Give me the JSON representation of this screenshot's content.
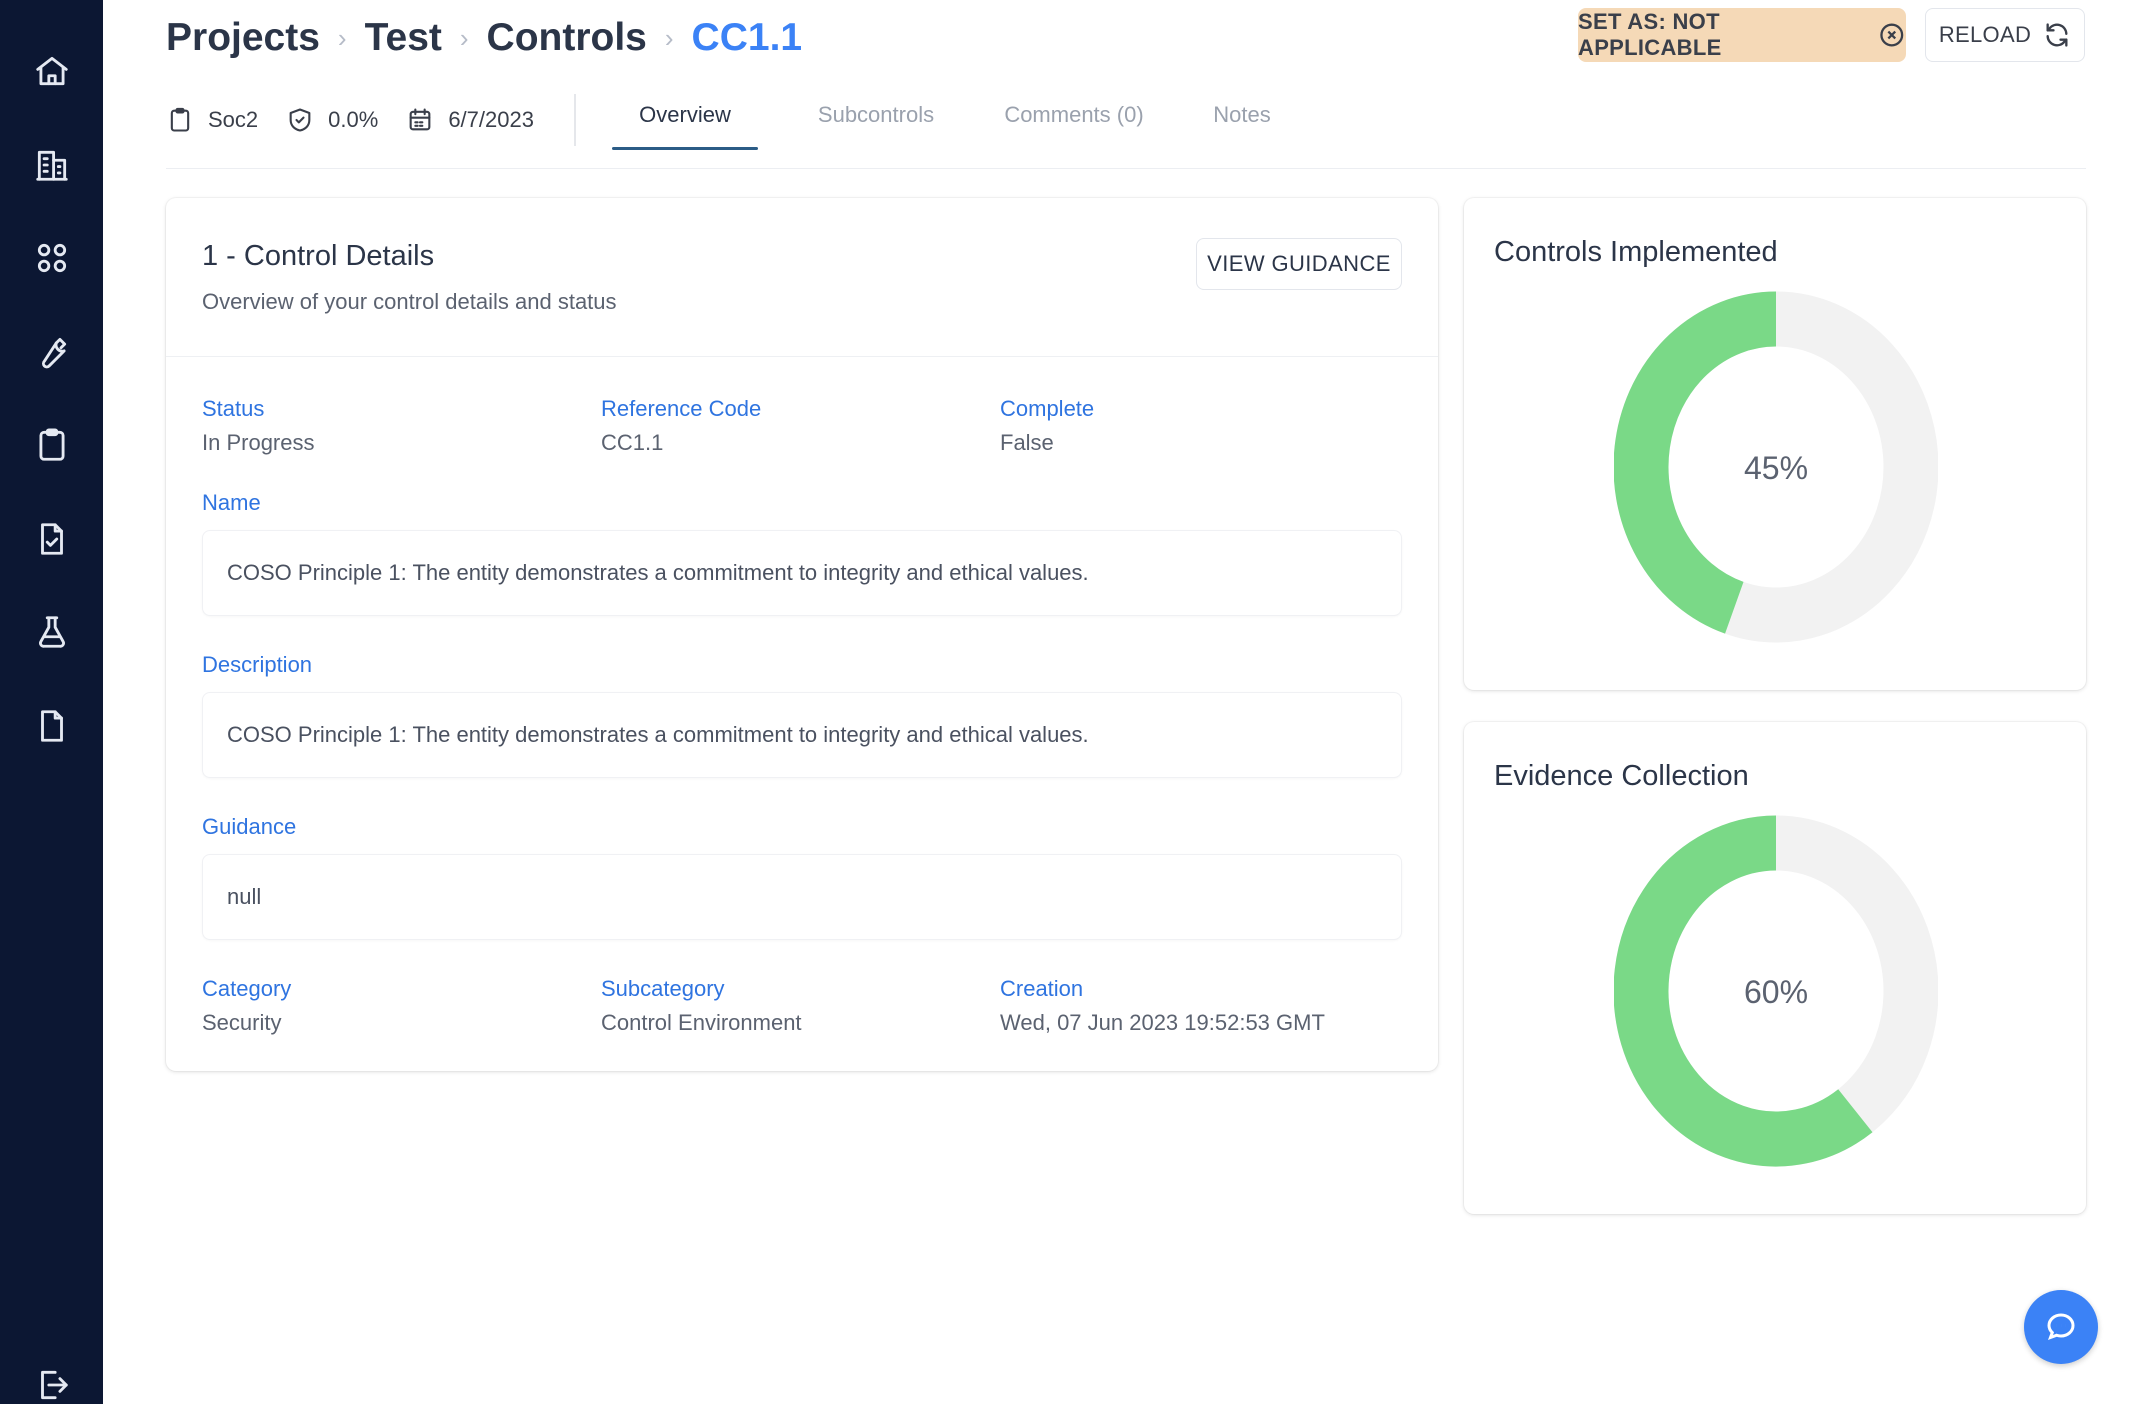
{
  "sidebar": {
    "items": [
      {
        "icon": "home-icon"
      },
      {
        "icon": "building-icon"
      },
      {
        "icon": "apps-grid-icon"
      },
      {
        "icon": "wrench-icon"
      },
      {
        "icon": "clipboard-icon"
      },
      {
        "icon": "document-check-icon"
      },
      {
        "icon": "flask-icon"
      },
      {
        "icon": "file-icon"
      }
    ],
    "logout_icon": "logout-icon"
  },
  "breadcrumb": {
    "items": [
      "Projects",
      "Test",
      "Controls"
    ],
    "current": "CC1.1",
    "separator": "›"
  },
  "header": {
    "set_na_label": "SET AS: NOT APPLICABLE",
    "reload_label": "RELOAD"
  },
  "meta": {
    "framework": "Soc2",
    "percent": "0.0%",
    "date": "6/7/2023"
  },
  "tabs": [
    {
      "label": "Overview",
      "active": true
    },
    {
      "label": "Subcontrols",
      "active": false
    },
    {
      "label": "Comments (0)",
      "active": false
    },
    {
      "label": "Notes",
      "active": false
    }
  ],
  "details": {
    "title": "1 - Control Details",
    "subtitle": "Overview of your control details and status",
    "view_guidance_label": "VIEW GUIDANCE",
    "status_label": "Status",
    "status_value": "In Progress",
    "reference_label": "Reference Code",
    "reference_value": "CC1.1",
    "complete_label": "Complete",
    "complete_value": "False",
    "name_label": "Name",
    "name_value": "COSO Principle 1: The entity demonstrates a commitment to integrity and ethical values.",
    "description_label": "Description",
    "description_value": "COSO Principle 1: The entity demonstrates a commitment to integrity and ethical values.",
    "guidance_label": "Guidance",
    "guidance_value": "null",
    "category_label": "Category",
    "category_value": "Security",
    "subcategory_label": "Subcategory",
    "subcategory_value": "Control Environment",
    "creation_label": "Creation",
    "creation_value": "Wed, 07 Jun 2023 19:52:53 GMT"
  },
  "donuts": [
    {
      "title": "Controls Implemented",
      "value": 45,
      "label": "45%"
    },
    {
      "title": "Evidence Collection",
      "value": 60,
      "label": "60%"
    }
  ],
  "colors": {
    "sidebar_bg": "#0c1733",
    "accent_blue": "#3b82f6",
    "label_blue": "#2f74e0",
    "donut_fill": "#7ad987",
    "donut_track": "#f2f2f2",
    "na_button_bg": "#f5d9b7"
  }
}
